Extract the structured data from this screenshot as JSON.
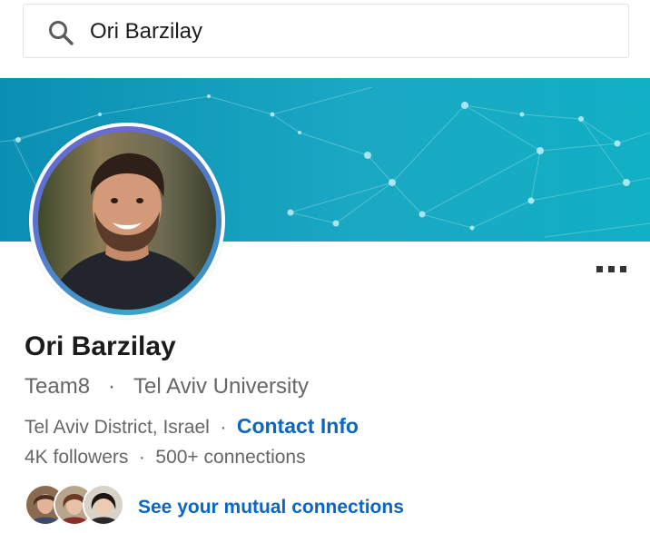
{
  "search": {
    "value": "Ori Barzilay",
    "icon": "search-icon"
  },
  "banner": {
    "colors": [
      "#0b8fb3",
      "#1aa8c3",
      "#12b0c4"
    ]
  },
  "profile": {
    "name": "Ori Barzilay",
    "company": "Team8",
    "separator": "·",
    "school": "Tel Aviv University",
    "location": "Tel Aviv District, Israel",
    "contact_info": "Contact Info",
    "followers": "4K followers",
    "connections": "500+ connections"
  },
  "menu": {
    "icon": "more-horizontal-icon"
  },
  "mutual": {
    "label": "See your mutual connections",
    "avatar_count": 3
  },
  "colors": {
    "link": "#0a66c2",
    "name": "#1b1b1b",
    "secondary": "#666666"
  }
}
